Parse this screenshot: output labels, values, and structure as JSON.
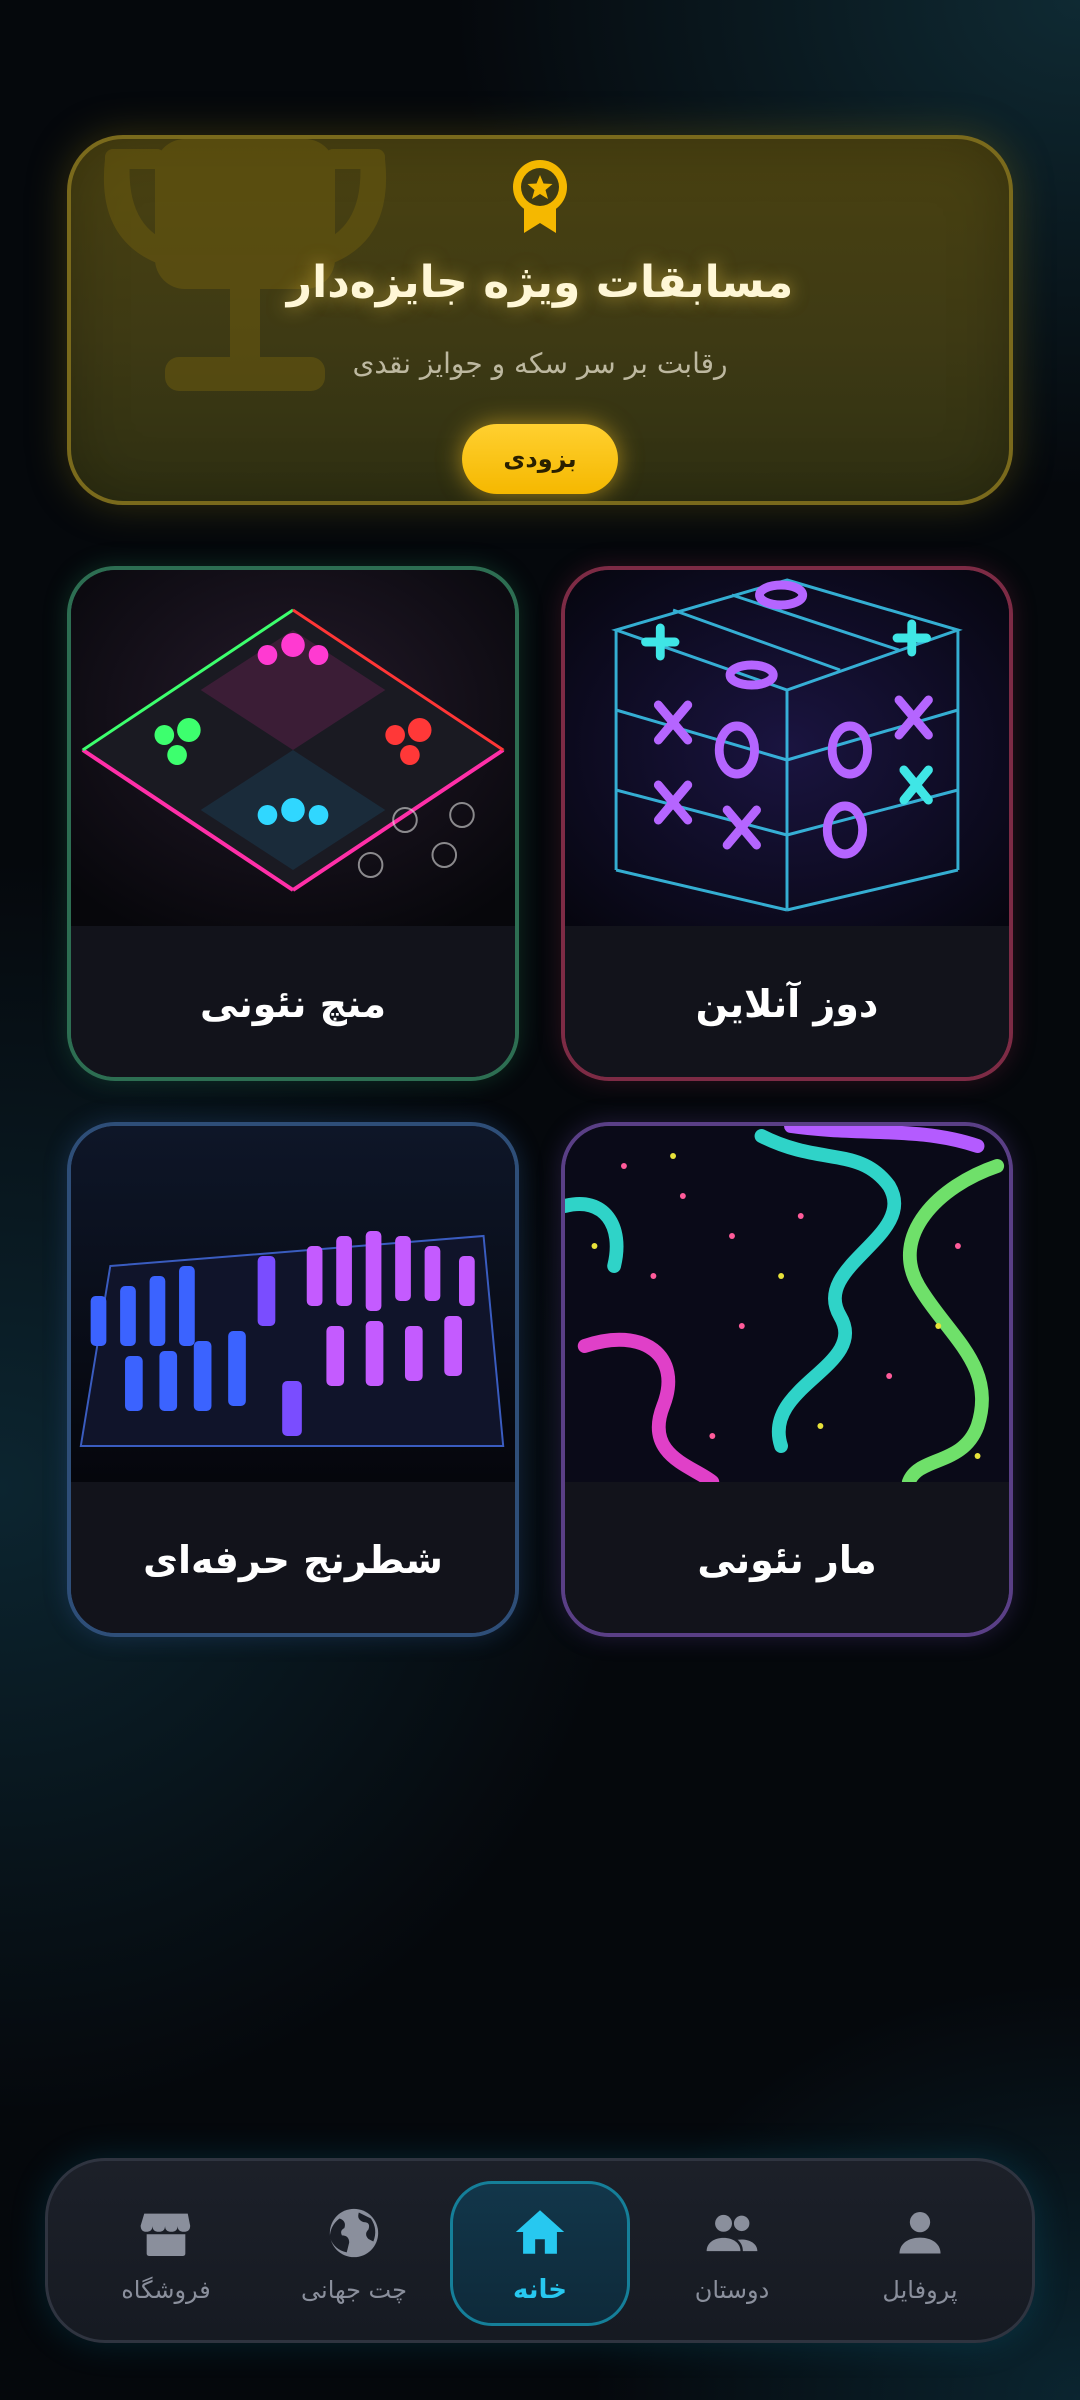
{
  "banner": {
    "title": "مسابقات ویژه جایزه‌دار",
    "subtitle": "رقابت بر سر سکه و جوایز نقدی",
    "button_label": "بزودی",
    "icon": "medal-icon",
    "accent": "#f5b800"
  },
  "games": [
    {
      "label": "دوز آنلاین",
      "art": "tic-tac-toe-cube",
      "border": "#7d2b45"
    },
    {
      "label": "منچ نئونی",
      "art": "neon-ludo-board",
      "border": "#2d6e52"
    },
    {
      "label": "مار نئونی",
      "art": "neon-snakes",
      "border": "#5a3f86"
    },
    {
      "label": "شطرنج حرفه‌ای",
      "art": "neon-chess-board",
      "border": "#2e4e78"
    }
  ],
  "nav": {
    "items": [
      {
        "label": "پروفایل",
        "icon": "person-icon",
        "active": false
      },
      {
        "label": "دوستان",
        "icon": "people-icon",
        "active": false
      },
      {
        "label": "خانه",
        "icon": "home-icon",
        "active": true
      },
      {
        "label": "چت جهانی",
        "icon": "globe-icon",
        "active": false
      },
      {
        "label": "فروشگاه",
        "icon": "store-icon",
        "active": false
      }
    ],
    "active_color": "#27c8f0"
  }
}
